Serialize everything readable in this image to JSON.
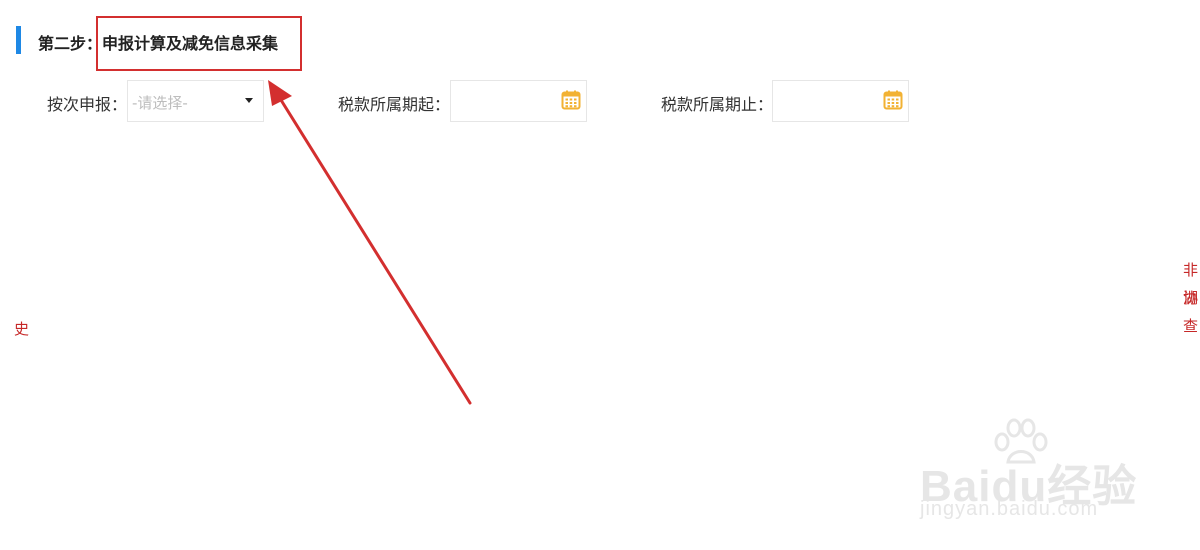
{
  "step": {
    "prefix": "第二步：",
    "title": "申报计算及减免信息采集"
  },
  "form": {
    "declare_by_time": {
      "label": "按次申报：",
      "placeholder": "-请选择-"
    },
    "tax_period_start": {
      "label": "税款所属期起：",
      "value": ""
    },
    "tax_period_end": {
      "label": "税款所属期止：",
      "value": ""
    }
  },
  "side_text": {
    "line1": "非湖",
    "line2": "协查"
  },
  "left_mark": "史",
  "watermark": {
    "logo": "Baidu经验",
    "url": "jingyan.baidu.com"
  },
  "icons": {
    "calendar": "calendar-icon",
    "dropdown": "chevron-down-icon"
  },
  "colors": {
    "accent_bar": "#1e88e5",
    "highlight": "#d32f2f",
    "calendar": "#f2b233"
  }
}
